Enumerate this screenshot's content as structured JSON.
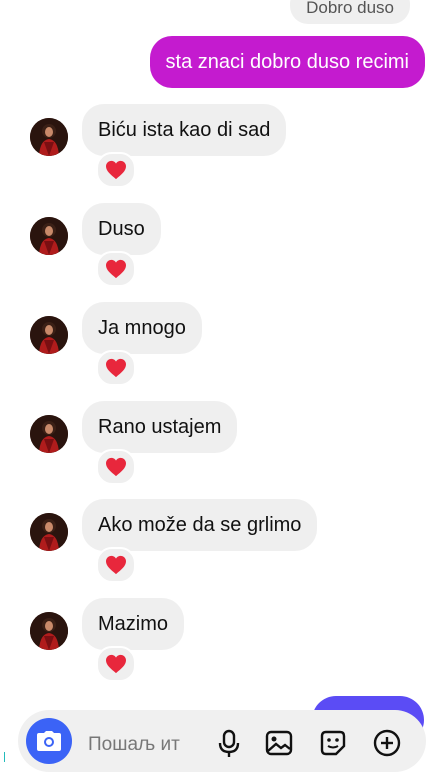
{
  "thread": {
    "top_received_cut": "Dobro duso",
    "sent_message": "sta znaci dobro duso recimi",
    "messages": [
      {
        "text": "Biću ista kao di sad",
        "reaction": "❤️"
      },
      {
        "text": "Duso",
        "reaction": "❤️"
      },
      {
        "text": "Ja mnogo",
        "reaction": "❤️"
      },
      {
        "text": "Rano ustajem",
        "reaction": "❤️"
      },
      {
        "text": "Ako može da se grlimo",
        "reaction": "❤️"
      },
      {
        "text": "Mazimo",
        "reaction": "❤️"
      }
    ]
  },
  "composer": {
    "placeholder": "Пошаљ ит",
    "icons": [
      "camera-icon",
      "mic-icon",
      "gallery-icon",
      "sticker-icon",
      "add-icon"
    ]
  },
  "colors": {
    "sent_bubble": "#c41bcf",
    "received_bubble": "#efefef",
    "camera_button": "#3b63f6",
    "partial_sent_bubble": "#5b4cf5"
  }
}
